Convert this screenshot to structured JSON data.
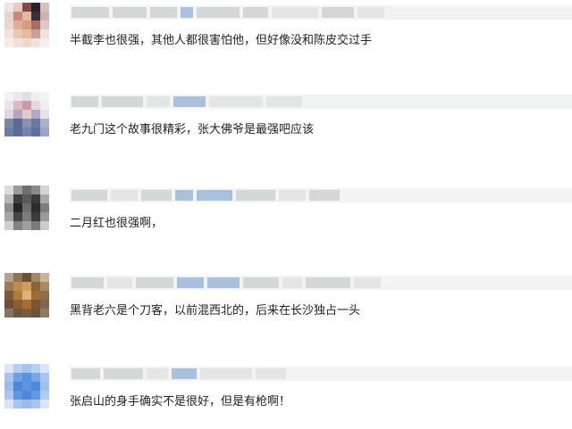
{
  "comments": [
    {
      "text": "半截李也很强，其他人都很害怕他，但好像没和陈皮交过手",
      "avatar": [
        "#f0e4e4",
        "#e8c9c5",
        "#7e4a48",
        "#2a2226",
        "#d8c0c0",
        "#e7d3cf",
        "#c9887a",
        "#e3b6a5",
        "#3c3036",
        "#c9b3b3",
        "#ead5cf",
        "#e1ad98",
        "#d99a82",
        "#a96e63",
        "#dec9c5",
        "#f1e2dd",
        "#ebc7b5",
        "#e7b9a3",
        "#caa098",
        "#efe3e0",
        "#f5ecea",
        "#f1dfd8",
        "#eed7cd",
        "#f0e2dd",
        "#f7efed"
      ]
    },
    {
      "text": "老九门这个故事很精彩，张大佛爷是最强吧应该",
      "avatar": [
        "#f3f1f4",
        "#ece7ee",
        "#e6dde8",
        "#f1eef2",
        "#f5f3f6",
        "#ebe4ec",
        "#d9b9c2",
        "#c99aa9",
        "#e6d6df",
        "#f0ecf1",
        "#dcd6e3",
        "#b5a6bd",
        "#e4c9c9",
        "#b4a8c5",
        "#e5e3ec",
        "#7e86a6",
        "#5d6a93",
        "#8a93b3",
        "#6a79a3",
        "#aab3cc",
        "#6e7da8",
        "#5b6c9b",
        "#7485ad",
        "#5f70a0",
        "#9aa6c4"
      ]
    },
    {
      "text": "二月红也很强啊，",
      "avatar": [
        "#dcdcdc",
        "#9b9b9b",
        "#6e6e6e",
        "#8b8b8b",
        "#d4d4d4",
        "#b7b7b7",
        "#3f3f3f",
        "#5a5a5a",
        "#3a3a3a",
        "#a8a8a8",
        "#8f8f8f",
        "#262626",
        "#6d6d6d",
        "#2d2d2d",
        "#7c7c7c",
        "#a5a5a5",
        "#454545",
        "#7b7b7b",
        "#3b3b3b",
        "#9a9a9a",
        "#cfcfcf",
        "#828282",
        "#9e9e9e",
        "#7a7a7a",
        "#cdcdcd"
      ]
    },
    {
      "text": "黑背老六是个刀客，以前混西北的，后来在长沙独占一头",
      "avatar": [
        "#b9a28b",
        "#8f7257",
        "#6a5138",
        "#a48664",
        "#c9b49c",
        "#9a7b56",
        "#c08a50",
        "#d49d5e",
        "#8a6337",
        "#a98a66",
        "#7e5b36",
        "#b07a3e",
        "#e0b27a",
        "#9d6c34",
        "#8b6e4f",
        "#6d5037",
        "#8c5f30",
        "#a86e31",
        "#7c552c",
        "#7d6550",
        "#8a735d",
        "#6f5640",
        "#7a5c40",
        "#6c533c",
        "#907a66"
      ]
    },
    {
      "text": "张启山的身手确实不是很好，但是有枪啊！",
      "avatar": [
        "#d9e6f7",
        "#b6cff0",
        "#a6c4ec",
        "#b8d0f1",
        "#dbe7f8",
        "#a7c4ee",
        "#6f9fe3",
        "#5a91df",
        "#79a6e6",
        "#aac6ef",
        "#9abced",
        "#4b86db",
        "#5e93e0",
        "#4f88dc",
        "#a0c0ee",
        "#a9c6ef",
        "#5f95e1",
        "#4c87dc",
        "#6298e2",
        "#b1cbf1",
        "#d6e5f8",
        "#a7c4ee",
        "#9ab9ec",
        "#a9c5ef",
        "#dae7f8"
      ]
    }
  ]
}
